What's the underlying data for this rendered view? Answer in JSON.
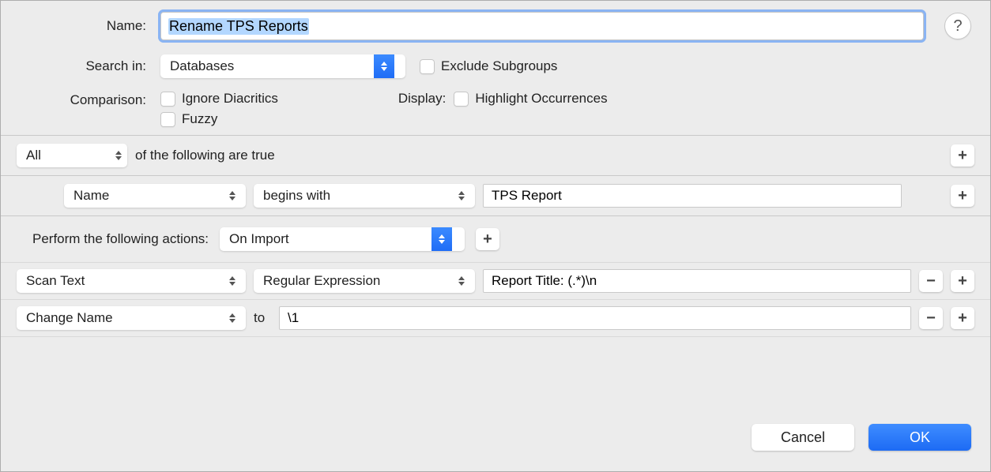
{
  "labels": {
    "name": "Name:",
    "searchIn": "Search in:",
    "comparison": "Comparison:",
    "display": "Display:",
    "to": "to",
    "performActions": "Perform the following actions:",
    "ofFollowing": "of the following are true"
  },
  "name": {
    "value": "Rename TPS Reports"
  },
  "searchIn": {
    "selected": "Databases"
  },
  "excludeSubgroups": {
    "label": "Exclude Subgroups",
    "checked": false
  },
  "ignoreDiacritics": {
    "label": "Ignore Diacritics",
    "checked": false
  },
  "fuzzy": {
    "label": "Fuzzy",
    "checked": false
  },
  "highlight": {
    "label": "Highlight Occurrences",
    "checked": false
  },
  "matchMode": {
    "selected": "All"
  },
  "condition": {
    "field": "Name",
    "operator": "begins with",
    "value": "TPS Report"
  },
  "trigger": {
    "selected": "On Import"
  },
  "action1": {
    "type": "Scan Text",
    "mode": "Regular Expression",
    "value": "Report Title: (.*)\\n"
  },
  "action2": {
    "type": "Change Name",
    "value": "\\1"
  },
  "buttons": {
    "cancel": "Cancel",
    "ok": "OK",
    "help": "?"
  },
  "icons": {
    "plus": "+",
    "minus": "−"
  }
}
